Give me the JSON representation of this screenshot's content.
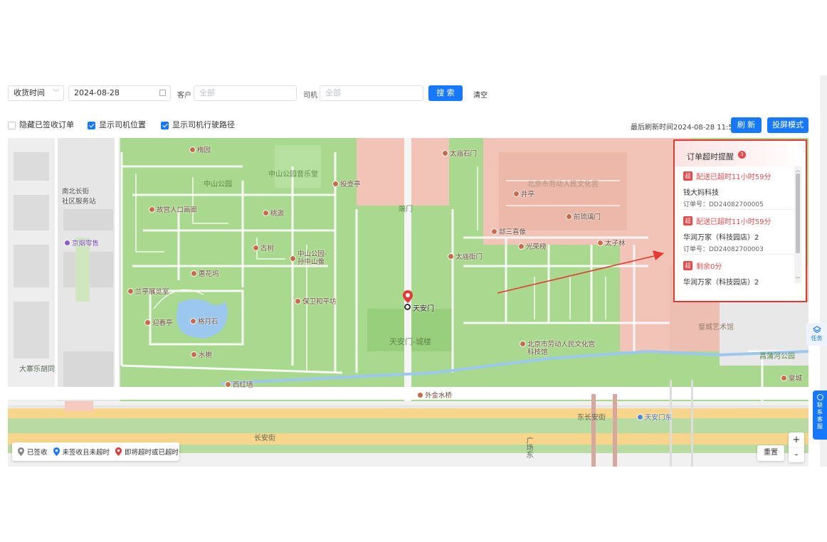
{
  "filters": {
    "time_type": "收货时间",
    "date": "2024-08-28",
    "customer_label": "客户",
    "customer_placeholder": "全部",
    "driver_label": "司机",
    "driver_placeholder": "全部",
    "search_label": "搜 索",
    "clear_label": "清空"
  },
  "options": {
    "hide_signed": {
      "label": "隐藏已签收订单",
      "checked": false
    },
    "show_driver_pos": {
      "label": "显示司机位置",
      "checked": true
    },
    "show_driver_route": {
      "label": "显示司机行驶路径",
      "checked": true
    }
  },
  "status": {
    "last_refresh": "最后刷新时间2024-08-28 11:59",
    "refresh_label": "刷 新",
    "screen_mode_label": "投屏模式"
  },
  "timeout_panel": {
    "title": "订单超时提醒",
    "count": "3",
    "badge": "超",
    "items": [
      {
        "alert": "配送已超时11小时59分",
        "customer": "钱大妈科技",
        "order_no": "订单号：DD24082700005"
      },
      {
        "alert": "配送已超时11小时59分",
        "customer": "华润万家（科技园店）2",
        "order_no": "订单号：DD24082700003"
      },
      {
        "alert": "剩余0分",
        "customer": "华润万家（科技园店）2",
        "order_no": ""
      }
    ]
  },
  "legend": {
    "signed": "已签收",
    "unsigned_ok": "未签收且未超时",
    "overdue": "即将超时或已超时"
  },
  "side": {
    "task_label": "任务",
    "contact_label": "联系客服"
  },
  "map": {
    "zoom_in": "+",
    "zoom_out": "-",
    "reset_label": "重置",
    "marker_label": "天安门",
    "areas": {
      "zhongshan_park": "中山公园",
      "concert_hall": "中山公园音乐堂",
      "duanmen": "端门",
      "workers_palace": "北京市劳动人民文化宫",
      "tiananmen_tower": "天安门-城楼",
      "imperial_art": "皇城艺术馆",
      "changpu_park": "菖蒲河公园"
    },
    "roads": {
      "dongchangan": "东长安街",
      "changan": "长安街",
      "damochang": "大寨乐胡同",
      "guangchang": "广场东"
    },
    "pois": {
      "meiyuan": "梅园",
      "taimiao_shimen": "太庙石门",
      "nanbei_changjie": "南北长街",
      "community": "社区服务站",
      "gugong_entrance": "故宫人口画廊",
      "yunxiang": "投壶亭",
      "tangxie": "桃源",
      "jingting": "井亭",
      "jingyanmen": "前琉璃门",
      "jingyan_shop": "京烟零售",
      "guyue": "古树",
      "sun_memorial": "中山公园-孙中山像",
      "weisanxiang": "部三喜像",
      "guangrong": "光荣榜",
      "taizilin": "太子林",
      "huihuashi": "惠花坞",
      "taimiaojie": "太庙街门",
      "lanting": "兰亭展览室",
      "baowei": "保卫和平坊",
      "geyue": "格月石",
      "shuixie": "水榭",
      "yingchun": "迎春亭",
      "workers_science": "北京市劳动人民文化宫科技馆",
      "xihongqiang": "西红墙",
      "waijinshui": "外金水桥",
      "huangcheng": "皇城",
      "tiananmen_east": "天安门东"
    }
  },
  "colors": {
    "primary": "#1677ff",
    "danger": "#e64a4a",
    "map_green": "#a9d98e",
    "map_pink": "#f2c4b8"
  }
}
